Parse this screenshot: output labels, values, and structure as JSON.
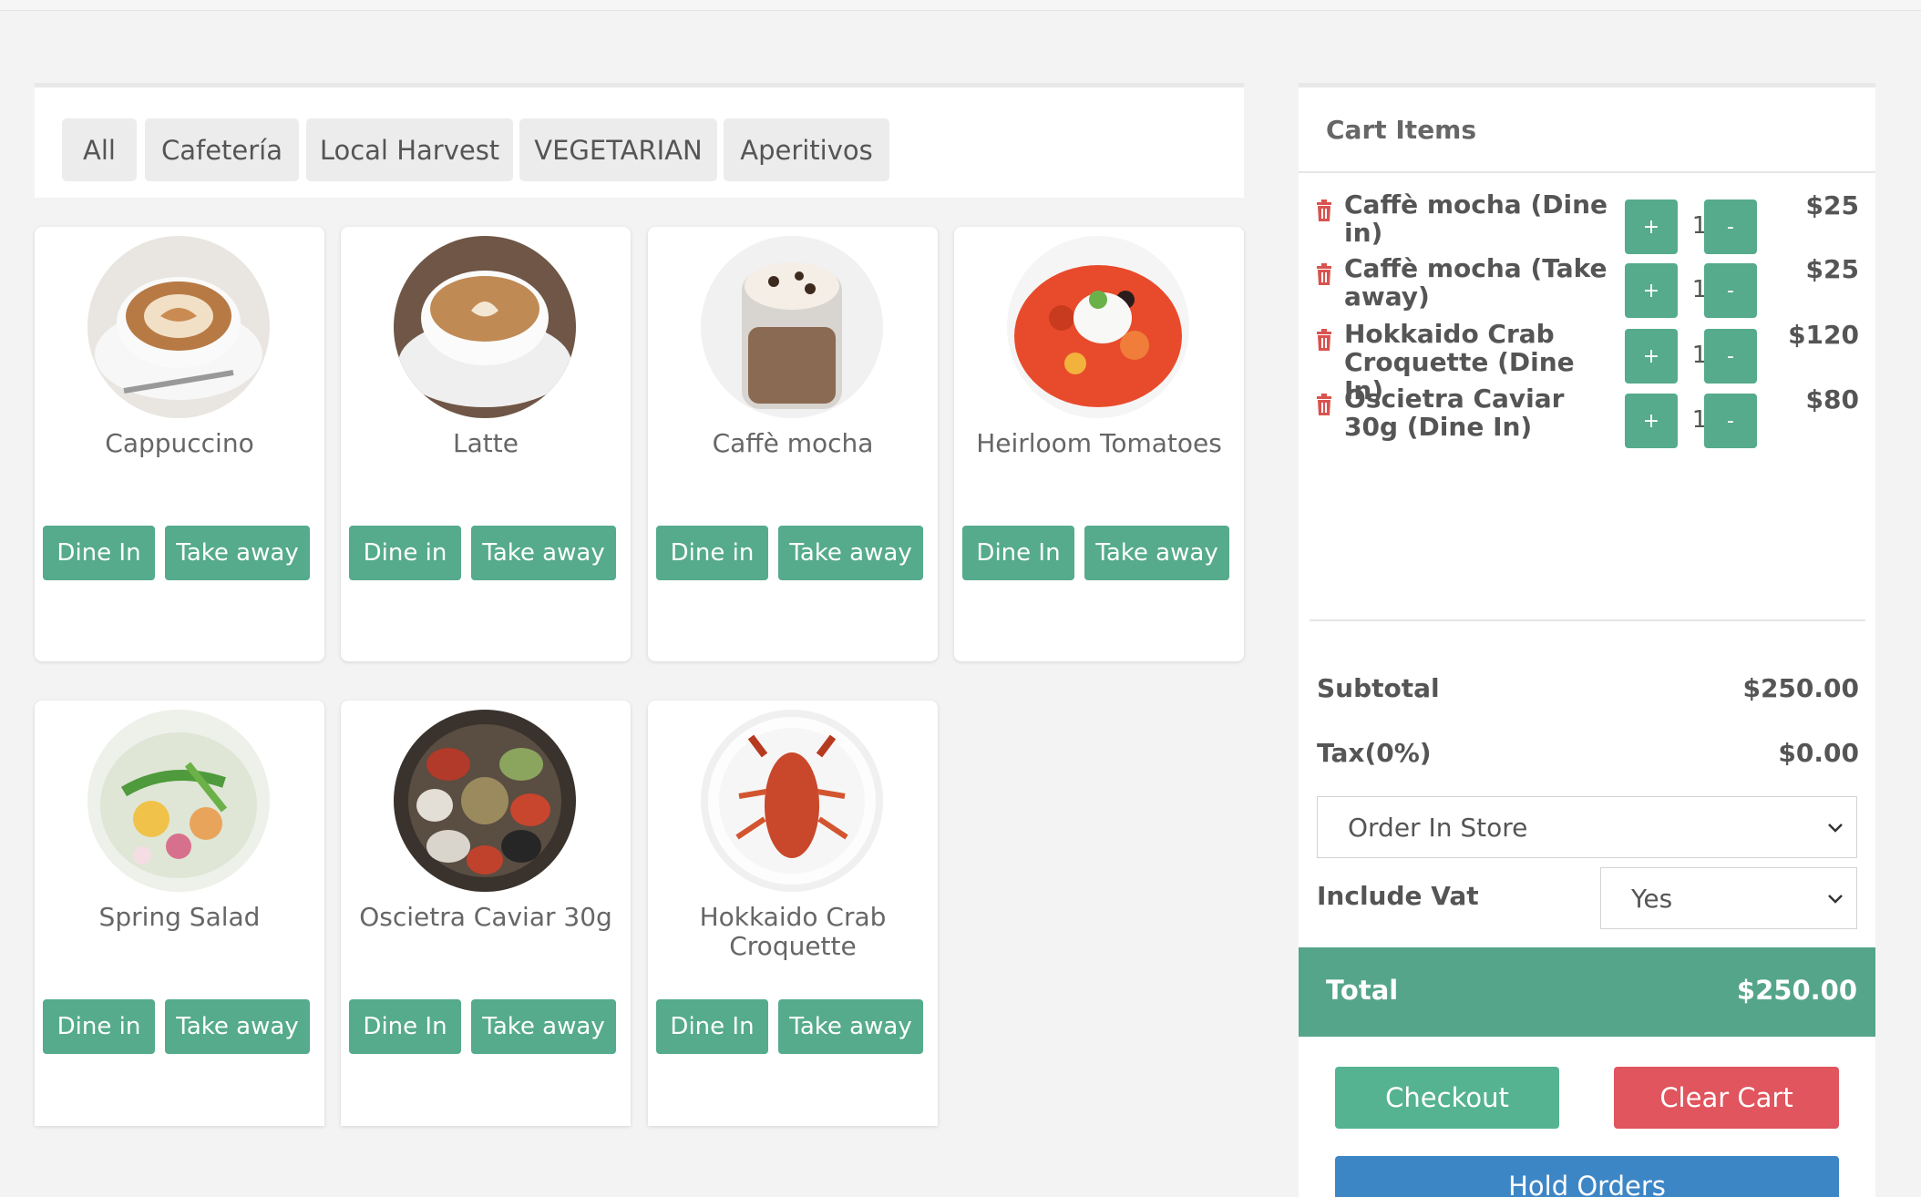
{
  "categories": [
    "All",
    "Cafetería",
    "Local Harvest",
    "VEGETARIAN",
    "Aperitivos"
  ],
  "products": [
    {
      "name": "Cappuccino",
      "dine_label": "Dine In",
      "take_label": "Take away",
      "icon": "cappuccino-photo"
    },
    {
      "name": "Latte",
      "dine_label": "Dine in",
      "take_label": "Take away",
      "icon": "latte-photo"
    },
    {
      "name": "Caffè mocha",
      "dine_label": "Dine in",
      "take_label": "Take away",
      "icon": "caffe-mocha-photo"
    },
    {
      "name": "Heirloom Tomatoes",
      "dine_label": "Dine In",
      "take_label": "Take away",
      "icon": "heirloom-tomatoes-photo"
    },
    {
      "name": "Spring Salad",
      "dine_label": "Dine in",
      "take_label": "Take away",
      "icon": "spring-salad-photo"
    },
    {
      "name": "Oscietra Caviar 30g",
      "dine_label": "Dine In",
      "take_label": "Take away",
      "icon": "oscietra-caviar-photo"
    },
    {
      "name": "Hokkaido Crab Croquette",
      "dine_label": "Dine In",
      "take_label": "Take away",
      "icon": "crab-croquette-photo"
    }
  ],
  "cart": {
    "title": "Cart Items",
    "items": [
      {
        "name": "Caffè mocha (Dine in)",
        "qty": "1",
        "price": "$25",
        "plus": "+",
        "minus": "-"
      },
      {
        "name": "Caffè mocha (Take away)",
        "qty": "1",
        "price": "$25",
        "plus": "+",
        "minus": "-"
      },
      {
        "name": "Hokkaido Crab Croquette (Dine In)",
        "qty": "1",
        "price": "$120",
        "plus": "+",
        "minus": "-"
      },
      {
        "name": "Oscietra Caviar 30g (Dine In)",
        "qty": "1",
        "price": "$80",
        "plus": "+",
        "minus": "-"
      }
    ],
    "subtotal_label": "Subtotal",
    "subtotal_value": "$250.00",
    "tax_label": "Tax(0%)",
    "tax_value": "$0.00",
    "order_type": "Order In Store",
    "vat_label": "Include Vat",
    "vat_value": "Yes",
    "total_label": "Total",
    "total_value": "$250.00",
    "checkout_label": "Checkout",
    "clear_label": "Clear Cart",
    "hold_label": "Hold Orders"
  },
  "colors": {
    "accent": "#55ab8c",
    "danger": "#e0555e",
    "primary": "#3d86c6",
    "trash": "#d9534f"
  }
}
